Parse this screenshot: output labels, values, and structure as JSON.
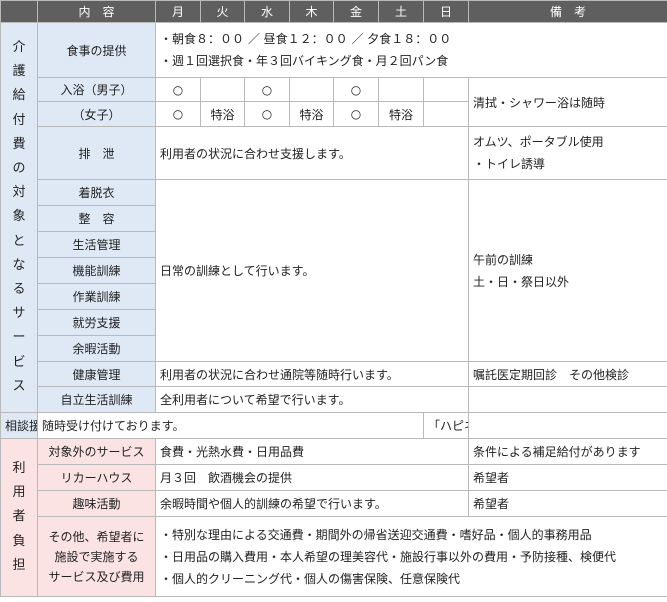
{
  "header": {
    "item": "内　容",
    "days": [
      "月",
      "火",
      "水",
      "木",
      "金",
      "土",
      "日"
    ],
    "note": "備　考"
  },
  "groups": {
    "covered": "介護給付費の対象となるサービス",
    "self_pay": "利用者負担"
  },
  "meals": {
    "label": "食事の提供",
    "line1": "・朝食８：００ ／ 昼食１２：００ ／ 夕食１８：００",
    "line2": "・週１回選択食・年３回バイキング食・月２回パン食"
  },
  "bath": {
    "male_label": "入浴（男子）",
    "male_days": [
      "○",
      "",
      "○",
      "",
      "○",
      "",
      ""
    ],
    "female_label": "（女子）",
    "female_days": [
      "○",
      "特浴",
      "○",
      "特浴",
      "○",
      "特浴",
      ""
    ],
    "note": "清拭・シャワー浴は随時"
  },
  "excretion": {
    "label": "排　泄",
    "content": "利用者の状況に合わせ支援します。",
    "note_line1": "オムツ、ポータブル使用",
    "note_line2": "・トイレ誘導"
  },
  "training": {
    "labels": [
      "着脱衣",
      "整　容",
      "生活管理",
      "機能訓練",
      "作業訓練",
      "就労支援",
      "余暇活動"
    ],
    "content": "日常の訓練として行います。",
    "note_line1": "午前の訓練",
    "note_line2": "土・日・祭日以外"
  },
  "health": {
    "label": "健康管理",
    "content": "利用者の状況に合わせ通院等随時行います。",
    "note": "嘱託医定期回診　その他検診"
  },
  "independence": {
    "label": "自立生活訓練",
    "content": "全利用者について希望で行います。",
    "note": ""
  },
  "consult": {
    "label": "相談援助",
    "content": "随時受け付けております。",
    "note": "「ハピネスボックス」も活用"
  },
  "excluded": {
    "label": "対象外のサービス",
    "content": "食費・光熱水費・日用品費",
    "note": "条件による補足給付があります"
  },
  "liquor": {
    "label": "リカーハウス",
    "content": "月３回　飲酒機会の提供",
    "note": "希望者"
  },
  "hobby": {
    "label": "趣味活動",
    "content": "余暇時間や個人的訓練の希望で行います。",
    "note": "希望者"
  },
  "other": {
    "label_line1": "その他、希望者に",
    "label_line2": "施設で実施する",
    "label_line3": "サービス及び費用",
    "line1": "・特別な理由による交通費・期間外の帰省送迎交通費・嗜好品・個人的事務用品",
    "line2": "・日用品の購入費用・本人希望の理美容代・施設行事以外の費用・予防接種、検便代",
    "line3": "・個人的クリーニング代・個人の傷害保険、任意保険代"
  }
}
